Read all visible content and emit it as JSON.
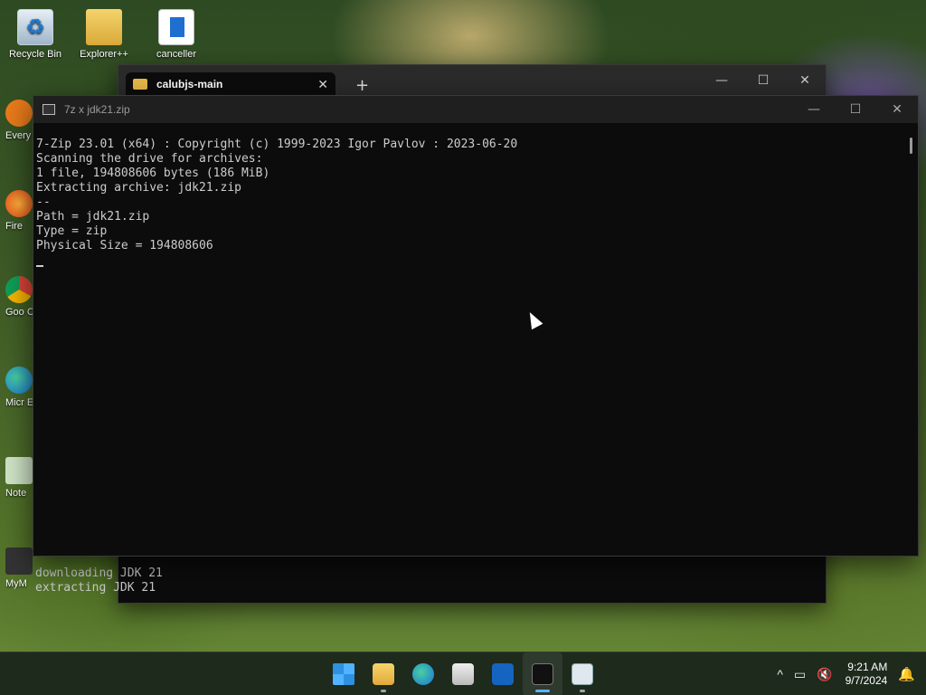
{
  "desktop": {
    "icons": [
      {
        "label": "Recycle Bin"
      },
      {
        "label": "Explorer++"
      },
      {
        "label": "canceller"
      }
    ],
    "side_icons": [
      {
        "label": "Every"
      },
      {
        "label": "Fire"
      },
      {
        "label": "Goo Chr"
      },
      {
        "label": "Micr Ed"
      },
      {
        "label": "Note"
      },
      {
        "label": "MyM"
      }
    ]
  },
  "back_window": {
    "tab_title": "calubjs-main",
    "new_tab": "+",
    "controls": {
      "minimize": "—",
      "maximize": "☐",
      "close": "✕"
    },
    "lines": [
      "downloading JDK 21",
      "extracting JDK 21"
    ]
  },
  "front_window": {
    "title": "7z  x jdk21.zip",
    "controls": {
      "minimize": "—",
      "maximize": "☐",
      "close": "✕"
    },
    "console_lines": [
      "7-Zip 23.01 (x64) : Copyright (c) 1999-2023 Igor Pavlov : 2023-06-20",
      "",
      "Scanning the drive for archives:",
      "1 file, 194808606 bytes (186 MiB)",
      "",
      "Extracting archive: jdk21.zip",
      "--",
      "Path = jdk21.zip",
      "Type = zip",
      "Physical Size = 194808606"
    ]
  },
  "taskbar": {
    "apps": [
      {
        "name": "start",
        "icon": "windows-start-icon"
      },
      {
        "name": "file-explorer",
        "icon": "folder-icon"
      },
      {
        "name": "edge",
        "icon": "edge-icon"
      },
      {
        "name": "store",
        "icon": "store-icon"
      },
      {
        "name": "outlook",
        "icon": "outlook-icon"
      },
      {
        "name": "terminal",
        "icon": "terminal-icon",
        "active": true
      },
      {
        "name": "notepad",
        "icon": "notepad-icon"
      }
    ],
    "tray": {
      "chevron": "^",
      "time": "9:21 AM",
      "date": "9/7/2024"
    }
  }
}
